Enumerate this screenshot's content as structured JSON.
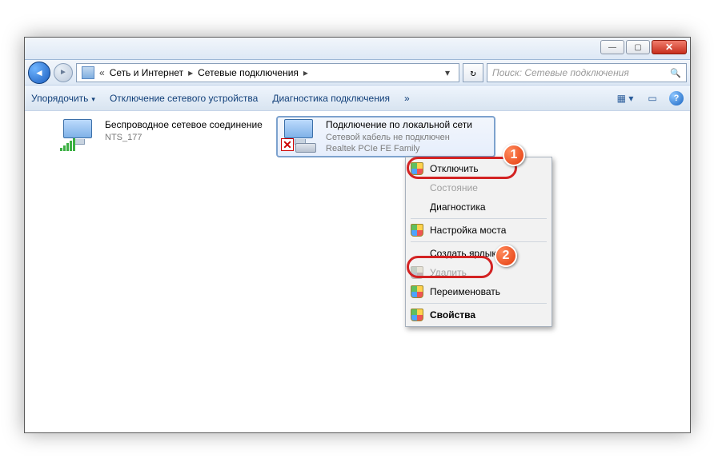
{
  "breadcrumb": [
    "Сеть и Интернет",
    "Сетевые подключения"
  ],
  "search": {
    "placeholder": "Поиск: Сетевые подключения"
  },
  "toolbar": {
    "organize": "Упорядочить",
    "disable": "Отключение сетевого устройства",
    "diagnose": "Диагностика подключения"
  },
  "connections": [
    {
      "title": "Беспроводное сетевое соединение",
      "network": "NTS_177"
    },
    {
      "title": "Подключение по локальной сети",
      "status": "Сетевой кабель не подключен",
      "device": "Realtek PCIe FE Family"
    }
  ],
  "menu": {
    "disable": "Отключить",
    "status": "Состояние",
    "diagnostics": "Диагностика",
    "bridge": "Настройка моста",
    "shortcut": "Создать ярлык",
    "delete": "Удалить",
    "rename": "Переименовать",
    "properties": "Свойства"
  },
  "annotations": [
    "1",
    "2"
  ]
}
